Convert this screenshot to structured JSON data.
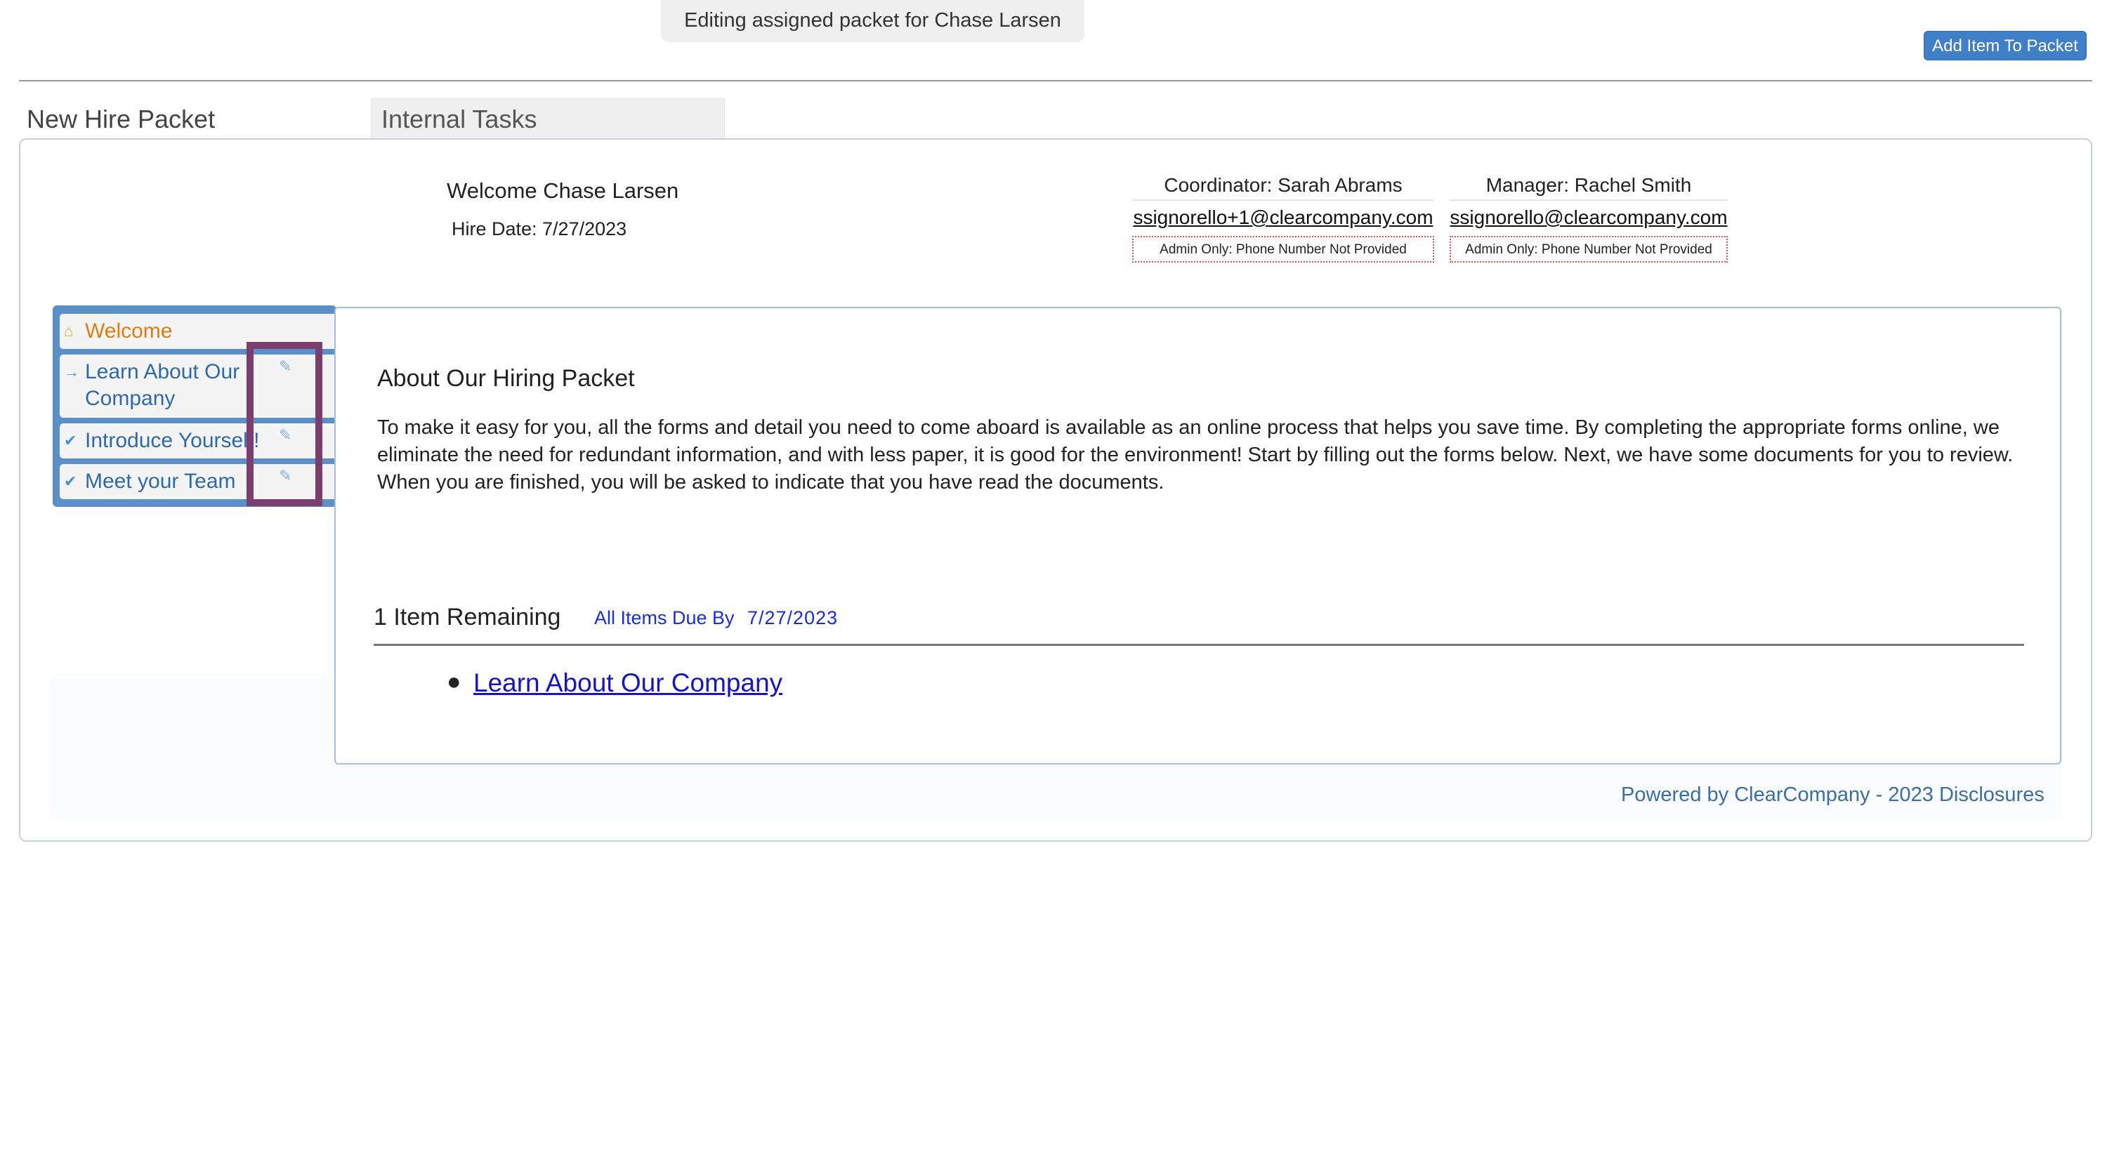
{
  "banner": {
    "text": "Editing assigned packet for Chase Larsen"
  },
  "toolbar": {
    "add_item_label": "Add Item To Packet"
  },
  "tabs": [
    {
      "label": "New Hire Packet"
    },
    {
      "label": "Internal Tasks"
    }
  ],
  "header": {
    "welcome": "Welcome Chase Larsen",
    "hire_date": "Hire Date: 7/27/2023",
    "coordinator": {
      "role": "Coordinator: Sarah Abrams",
      "email": "ssignorello+1@clearcompany.com",
      "phone": "Admin Only: Phone Number Not Provided"
    },
    "manager": {
      "role": "Manager: Rachel Smith",
      "email": "ssignorello@clearcompany.com",
      "phone": "Admin Only: Phone Number Not Provided"
    }
  },
  "sidebar": {
    "items": [
      {
        "label": "Welcome",
        "icon": "home-icon",
        "state": "active"
      },
      {
        "label": "Learn About Our Company",
        "icon": "arrow-right-icon",
        "state": "current"
      },
      {
        "label": "Introduce Yourself!",
        "icon": "check-icon",
        "state": "complete"
      },
      {
        "label": "Meet your Team",
        "icon": "check-icon",
        "state": "complete"
      }
    ],
    "edit_icon": "pencil-icon"
  },
  "content": {
    "title": "About Our Hiring Packet",
    "body": "To make it easy for you, all the forms and detail you need to come aboard is available as an online process that helps you save time. By completing the appropriate forms online, we eliminate the need for redundant information, and with less paper, it is good for the environment! Start by filling out the forms below. Next, we have some documents for you to review. When you are finished, you will be asked to indicate that you have read the documents.",
    "remaining_label": "1 Item Remaining",
    "due_label": "All Items Due By",
    "due_date": "7/27/2023",
    "remaining_items": [
      "Learn About Our Company"
    ]
  },
  "footer": {
    "powered_by": "Powered by ClearCompany - 2023 Disclosures"
  },
  "colors": {
    "accent": "#3f7fc7",
    "sidebar": "#5b8fc9",
    "welcome_orange": "#e07d10",
    "link_blue": "#1515c4",
    "highlight": "#7b3d6e"
  }
}
